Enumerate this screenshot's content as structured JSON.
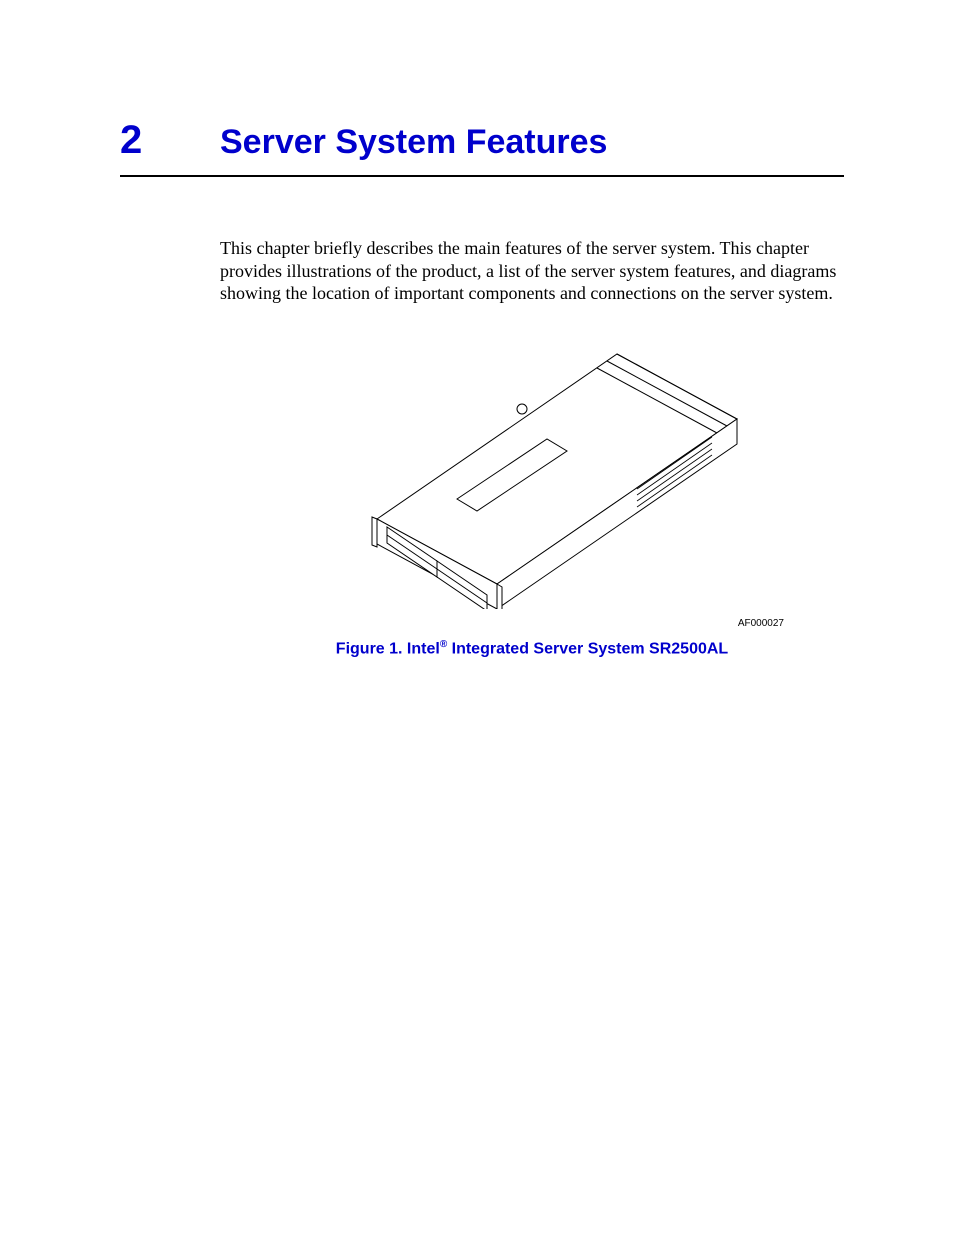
{
  "chapter": {
    "number": "2",
    "title": "Server System Features"
  },
  "intro": "This chapter briefly describes the main features of the server system. This chapter provides illustrations of the product, a list of the server system features, and diagrams showing the location of important components and connections on the server system.",
  "figure": {
    "id_label": "AF000027",
    "caption_prefix": "Figure 1. Intel",
    "caption_reg": "®",
    "caption_suffix": " Integrated Server System SR2500AL"
  }
}
